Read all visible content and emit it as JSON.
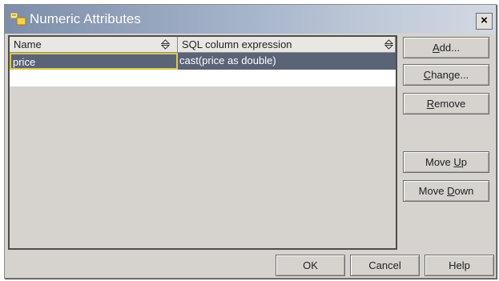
{
  "window": {
    "title": "Numeric Attributes",
    "close_label": "×"
  },
  "table": {
    "columns": [
      "Name",
      "SQL column expression"
    ],
    "rows": [
      {
        "name": "price",
        "expression": "cast(price as double)"
      }
    ]
  },
  "side_buttons": {
    "add": {
      "mnemonic": "A",
      "rest": "dd..."
    },
    "change": {
      "mnemonic": "C",
      "rest": "hange..."
    },
    "remove": {
      "mnemonic": "R",
      "rest": "emove"
    },
    "move_up": {
      "pre": "Move ",
      "mnemonic": "U",
      "rest": "p"
    },
    "move_down": {
      "pre": "Move ",
      "mnemonic": "D",
      "rest": "own"
    }
  },
  "footer_buttons": {
    "ok": "OK",
    "cancel": "Cancel",
    "help": "Help"
  },
  "colors": {
    "dialog_bg": "#d6d3ce",
    "selection": "#5b6377",
    "focus_border": "#d8c94c",
    "title_gradient_start": "#7d8eaa"
  }
}
